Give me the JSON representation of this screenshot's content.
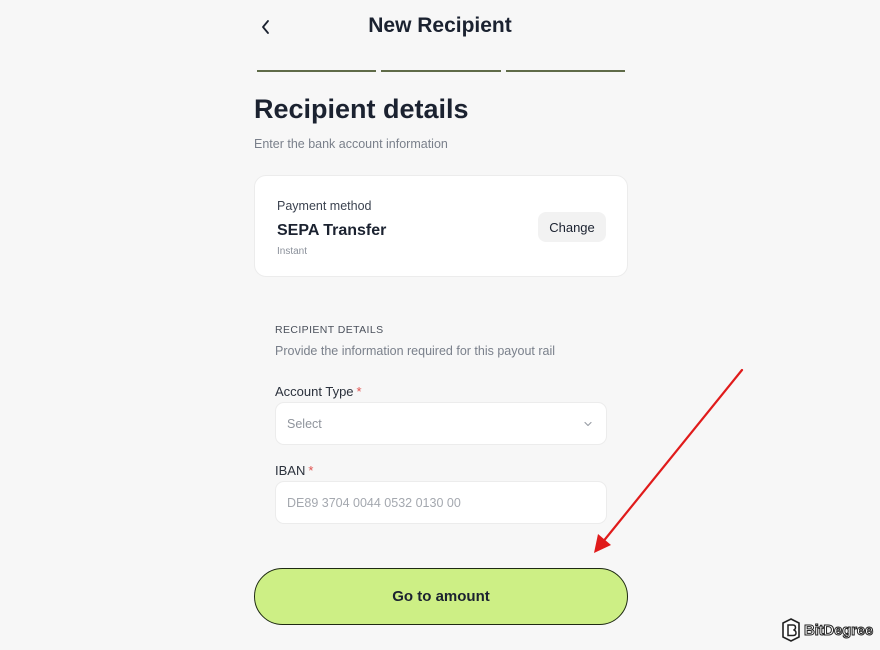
{
  "header": {
    "title": "New Recipient",
    "back_icon": "chevron-left-icon",
    "progress_steps": 3
  },
  "main": {
    "title": "Recipient details",
    "subtitle": "Enter the bank account information"
  },
  "payment_method": {
    "label": "Payment method",
    "name": "SEPA Transfer",
    "speed": "Instant",
    "change_label": "Change"
  },
  "recipient_section": {
    "heading": "RECIPIENT DETAILS",
    "description": "Provide the information required for this payout rail"
  },
  "fields": {
    "account_type": {
      "label": "Account Type",
      "required_mark": "*",
      "selected": "Select"
    },
    "iban": {
      "label": "IBAN",
      "required_mark": "*",
      "placeholder": "DE89 3704 0044 0532 0130 00"
    }
  },
  "cta": {
    "label": "Go to amount"
  },
  "annotation": {
    "color": "#e01b1b"
  },
  "watermark": {
    "text": "BitDegree",
    "icon": "bitdegree-logo-icon"
  }
}
